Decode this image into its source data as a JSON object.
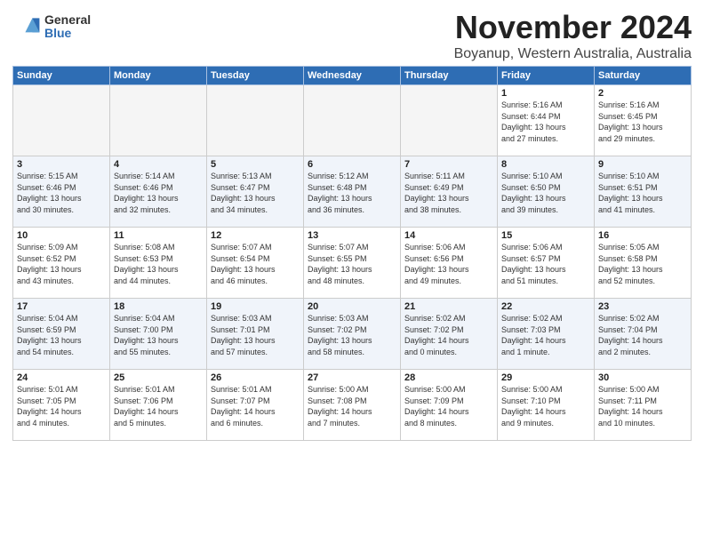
{
  "header": {
    "logo_general": "General",
    "logo_blue": "Blue",
    "month": "November 2024",
    "location": "Boyanup, Western Australia, Australia"
  },
  "weekdays": [
    "Sunday",
    "Monday",
    "Tuesday",
    "Wednesday",
    "Thursday",
    "Friday",
    "Saturday"
  ],
  "weeks": [
    [
      {
        "day": "",
        "info": ""
      },
      {
        "day": "",
        "info": ""
      },
      {
        "day": "",
        "info": ""
      },
      {
        "day": "",
        "info": ""
      },
      {
        "day": "",
        "info": ""
      },
      {
        "day": "1",
        "info": "Sunrise: 5:16 AM\nSunset: 6:44 PM\nDaylight: 13 hours\nand 27 minutes."
      },
      {
        "day": "2",
        "info": "Sunrise: 5:16 AM\nSunset: 6:45 PM\nDaylight: 13 hours\nand 29 minutes."
      }
    ],
    [
      {
        "day": "3",
        "info": "Sunrise: 5:15 AM\nSunset: 6:46 PM\nDaylight: 13 hours\nand 30 minutes."
      },
      {
        "day": "4",
        "info": "Sunrise: 5:14 AM\nSunset: 6:46 PM\nDaylight: 13 hours\nand 32 minutes."
      },
      {
        "day": "5",
        "info": "Sunrise: 5:13 AM\nSunset: 6:47 PM\nDaylight: 13 hours\nand 34 minutes."
      },
      {
        "day": "6",
        "info": "Sunrise: 5:12 AM\nSunset: 6:48 PM\nDaylight: 13 hours\nand 36 minutes."
      },
      {
        "day": "7",
        "info": "Sunrise: 5:11 AM\nSunset: 6:49 PM\nDaylight: 13 hours\nand 38 minutes."
      },
      {
        "day": "8",
        "info": "Sunrise: 5:10 AM\nSunset: 6:50 PM\nDaylight: 13 hours\nand 39 minutes."
      },
      {
        "day": "9",
        "info": "Sunrise: 5:10 AM\nSunset: 6:51 PM\nDaylight: 13 hours\nand 41 minutes."
      }
    ],
    [
      {
        "day": "10",
        "info": "Sunrise: 5:09 AM\nSunset: 6:52 PM\nDaylight: 13 hours\nand 43 minutes."
      },
      {
        "day": "11",
        "info": "Sunrise: 5:08 AM\nSunset: 6:53 PM\nDaylight: 13 hours\nand 44 minutes."
      },
      {
        "day": "12",
        "info": "Sunrise: 5:07 AM\nSunset: 6:54 PM\nDaylight: 13 hours\nand 46 minutes."
      },
      {
        "day": "13",
        "info": "Sunrise: 5:07 AM\nSunset: 6:55 PM\nDaylight: 13 hours\nand 48 minutes."
      },
      {
        "day": "14",
        "info": "Sunrise: 5:06 AM\nSunset: 6:56 PM\nDaylight: 13 hours\nand 49 minutes."
      },
      {
        "day": "15",
        "info": "Sunrise: 5:06 AM\nSunset: 6:57 PM\nDaylight: 13 hours\nand 51 minutes."
      },
      {
        "day": "16",
        "info": "Sunrise: 5:05 AM\nSunset: 6:58 PM\nDaylight: 13 hours\nand 52 minutes."
      }
    ],
    [
      {
        "day": "17",
        "info": "Sunrise: 5:04 AM\nSunset: 6:59 PM\nDaylight: 13 hours\nand 54 minutes."
      },
      {
        "day": "18",
        "info": "Sunrise: 5:04 AM\nSunset: 7:00 PM\nDaylight: 13 hours\nand 55 minutes."
      },
      {
        "day": "19",
        "info": "Sunrise: 5:03 AM\nSunset: 7:01 PM\nDaylight: 13 hours\nand 57 minutes."
      },
      {
        "day": "20",
        "info": "Sunrise: 5:03 AM\nSunset: 7:02 PM\nDaylight: 13 hours\nand 58 minutes."
      },
      {
        "day": "21",
        "info": "Sunrise: 5:02 AM\nSunset: 7:02 PM\nDaylight: 14 hours\nand 0 minutes."
      },
      {
        "day": "22",
        "info": "Sunrise: 5:02 AM\nSunset: 7:03 PM\nDaylight: 14 hours\nand 1 minute."
      },
      {
        "day": "23",
        "info": "Sunrise: 5:02 AM\nSunset: 7:04 PM\nDaylight: 14 hours\nand 2 minutes."
      }
    ],
    [
      {
        "day": "24",
        "info": "Sunrise: 5:01 AM\nSunset: 7:05 PM\nDaylight: 14 hours\nand 4 minutes."
      },
      {
        "day": "25",
        "info": "Sunrise: 5:01 AM\nSunset: 7:06 PM\nDaylight: 14 hours\nand 5 minutes."
      },
      {
        "day": "26",
        "info": "Sunrise: 5:01 AM\nSunset: 7:07 PM\nDaylight: 14 hours\nand 6 minutes."
      },
      {
        "day": "27",
        "info": "Sunrise: 5:00 AM\nSunset: 7:08 PM\nDaylight: 14 hours\nand 7 minutes."
      },
      {
        "day": "28",
        "info": "Sunrise: 5:00 AM\nSunset: 7:09 PM\nDaylight: 14 hours\nand 8 minutes."
      },
      {
        "day": "29",
        "info": "Sunrise: 5:00 AM\nSunset: 7:10 PM\nDaylight: 14 hours\nand 9 minutes."
      },
      {
        "day": "30",
        "info": "Sunrise: 5:00 AM\nSunset: 7:11 PM\nDaylight: 14 hours\nand 10 minutes."
      }
    ]
  ]
}
